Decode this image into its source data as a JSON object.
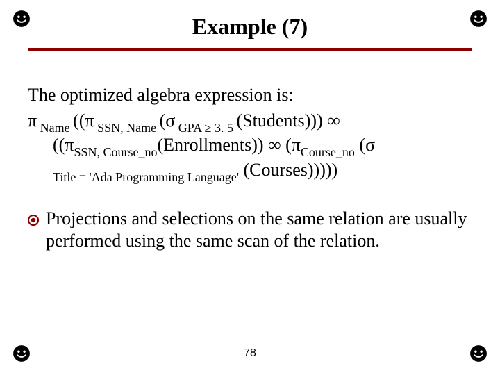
{
  "title": "Example (7)",
  "intro": "The optimized algebra expression is:",
  "expr": {
    "pi": "π",
    "sigma": "σ",
    "infty": "∞",
    "ge": "≥",
    "name_sub": " Name ",
    "ssn_name_sub": " SSN, Name ",
    "gpa_sub": " GPA ",
    "gpa_val": " 3. 5 ",
    "students": "(Students))) ",
    "ssn_course_sub": "SSN, Course_no",
    "enrollments": "(Enrollments)) ",
    "course_no_sub": "Course_no",
    "title_sub": "Title = 'Ada Programming Language'",
    "courses": " (Courses)))))",
    "open2": " ((",
    "open1": " (",
    "line2_open": "(("
  },
  "bullet": "Projections and selections on the same relation are usually performed using the same scan of the relation.",
  "page": "78",
  "icons": {
    "corner": "corner-smiley-icon",
    "bullet": "bullet-disc-icon"
  }
}
